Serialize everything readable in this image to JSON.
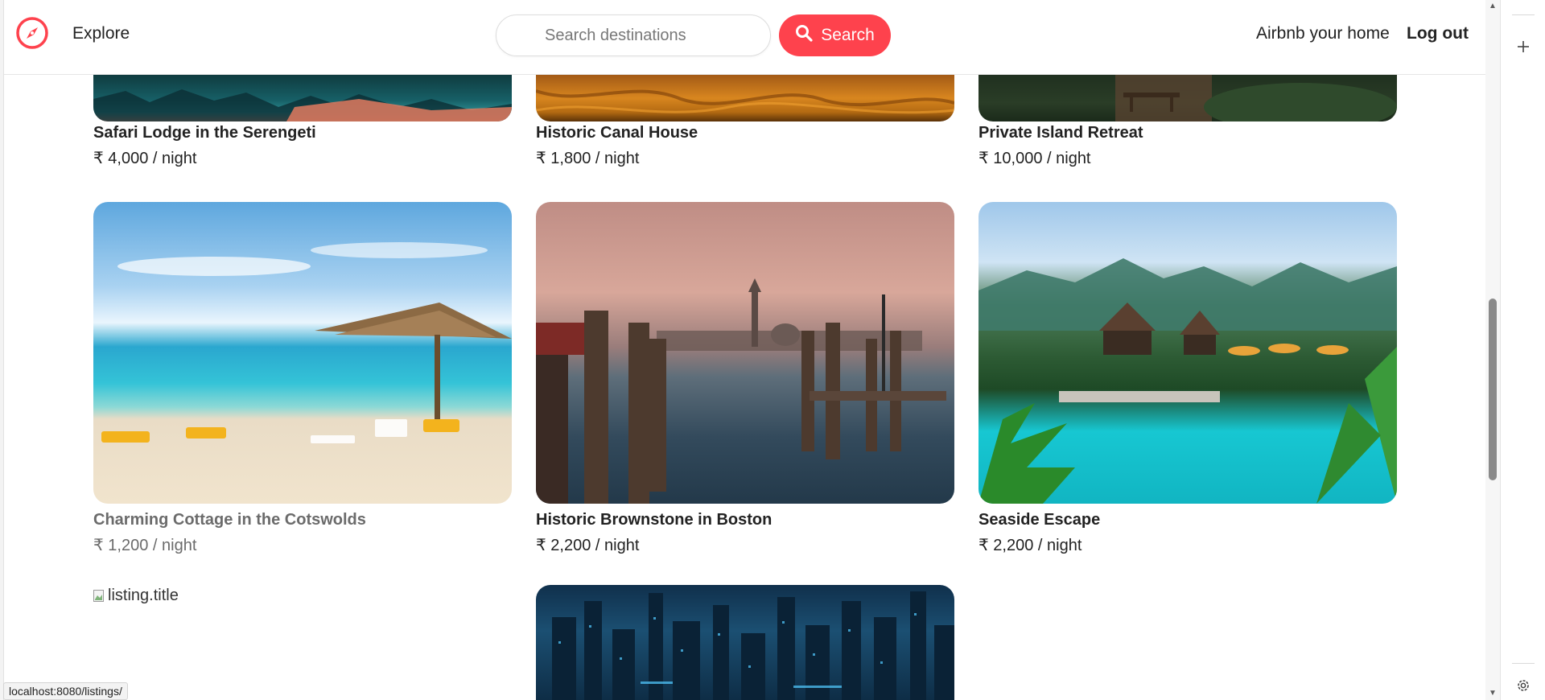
{
  "nav": {
    "explore_label": "Explore",
    "search_placeholder": "Search destinations",
    "search_button_label": "Search",
    "host_label": "Airbnb your home",
    "logout_label": "Log out",
    "brand_color": "#fe424d",
    "logo_icon": "compass-icon"
  },
  "listings": [
    {
      "title": "Safari Lodge in the Serengeti",
      "price": "₹ 4,000 / night",
      "image": "lake-mountain-reflection"
    },
    {
      "title": "Historic Canal House",
      "price": "₹ 1,800 / night",
      "image": "orange-fabric"
    },
    {
      "title": "Private Island Retreat",
      "price": "₹ 10,000 / night",
      "image": "forest-picnic"
    },
    {
      "title": "Charming Cottage in the Cotswolds",
      "price": "₹ 1,200 / night",
      "image": "beach-umbrella"
    },
    {
      "title": "Historic Brownstone in Boston",
      "price": "₹ 2,200 / night",
      "image": "venice-pier"
    },
    {
      "title": "Seaside Escape",
      "price": "₹ 2,200 / night",
      "image": "tropical-pool-resort"
    },
    {
      "title": "",
      "price": "",
      "image_alt": "listing.title"
    },
    {
      "title": "",
      "price": "",
      "image": "futuristic-city"
    }
  ],
  "status_bar": {
    "url": "localhost:8080/listings/"
  },
  "scroll": {
    "position_fraction": 0.58
  }
}
